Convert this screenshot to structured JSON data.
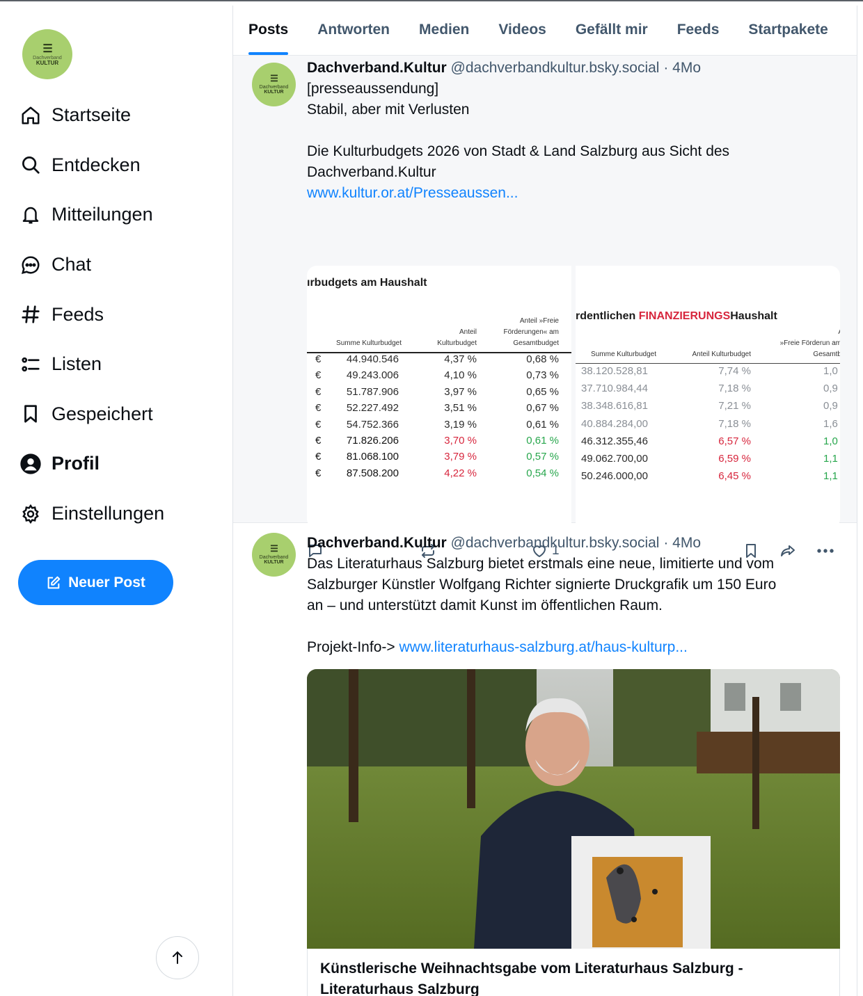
{
  "sidebar": {
    "avatar": {
      "brand_small": "Dachverband",
      "brand": "KULTUR"
    },
    "items": [
      {
        "label": "Startseite",
        "icon": "home-icon"
      },
      {
        "label": "Entdecken",
        "icon": "search-icon"
      },
      {
        "label": "Mitteilungen",
        "icon": "bell-icon"
      },
      {
        "label": "Chat",
        "icon": "chat-bubble-icon"
      },
      {
        "label": "Feeds",
        "icon": "hash-icon"
      },
      {
        "label": "Listen",
        "icon": "list-icon"
      },
      {
        "label": "Gespeichert",
        "icon": "bookmark-icon"
      },
      {
        "label": "Profil",
        "icon": "person-icon"
      },
      {
        "label": "Einstellungen",
        "icon": "gear-icon"
      }
    ],
    "active_item": "Profil",
    "new_post_label": "Neuer Post"
  },
  "tabs": [
    "Posts",
    "Antworten",
    "Medien",
    "Videos",
    "Gefällt mir",
    "Feeds",
    "Startpakete"
  ],
  "active_tab": "Posts",
  "accent_color": "#1083fe",
  "posts": [
    {
      "author": "Dachverband.Kultur",
      "handle": "@dachverbandkultur.bsky.social",
      "dot": "·",
      "time": "4Mo",
      "lines": [
        "[presseaussendung]",
        "Stabil, aber mit Verlusten",
        "",
        "Die Kulturbudgets 2026 von Stadt & Land Salzburg aus Sicht des",
        "Dachverband.Kultur"
      ],
      "link": "www.kultur.or.at/Presseaussen...",
      "table_left": {
        "title": "ırbudgets am Haushalt",
        "headers": [
          "Summe Kulturbudget",
          "Anteil Kulturbudget",
          "Anteil »Freie Förderungen« am Gesamtbudget"
        ],
        "currency": "€",
        "rows": [
          [
            "44.940.546",
            "4,37 %",
            "0,68 %"
          ],
          [
            "49.243.006",
            "4,10 %",
            "0,73 %"
          ],
          [
            "51.787.906",
            "3,97 %",
            "0,65 %"
          ],
          [
            "52.227.492",
            "3,51 %",
            "0,67 %"
          ],
          [
            "54.752.366",
            "3,19 %",
            "0,61 %"
          ],
          [
            "71.826.206",
            "3,70 %",
            "0,61 %"
          ],
          [
            "81.068.100",
            "3,79 %",
            "0,57 %"
          ],
          [
            "87.508.200",
            "4,22 %",
            "0,54 %"
          ]
        ]
      },
      "table_right": {
        "title_prefix": "rdentlichen ",
        "title_red": "FINANZIERUNGS",
        "title_suffix": "Haushalt",
        "headers": [
          "Summe Kulturbudget",
          "Anteil Kulturbudget",
          "»Freie Förderun am Gesamtb"
        ],
        "header_extra": "A",
        "rows": [
          [
            "38.120.528,81",
            "7,74 %",
            "1,0"
          ],
          [
            "37.710.984,44",
            "7,18 %",
            "0,9"
          ],
          [
            "38.348.616,81",
            "7,21 %",
            "0,9"
          ],
          [
            "40.884.284,00",
            "7,18 %",
            "1,6"
          ],
          [
            "46.312.355,46",
            "6,57 %",
            "1,0"
          ],
          [
            "49.062.700,00",
            "6,59 %",
            "1,1"
          ],
          [
            "50.246.000,00",
            "6,45 %",
            "1,1"
          ]
        ]
      },
      "like_count": "1"
    },
    {
      "author": "Dachverband.Kultur",
      "handle": "@dachverbandkultur.bsky.social",
      "dot": "·",
      "time": "4Mo",
      "lines": [
        "Das Literaturhaus Salzburg bietet erstmals eine neue, limitierte und vom",
        "Salzburger Künstler Wolfgang Richter signierte Druckgrafik um 150 Euro",
        "an – und unterstützt damit Kunst im öffentlichen Raum.",
        ""
      ],
      "link_prefix": "Projekt-Info-> ",
      "link": "www.literaturhaus-salzburg.at/haus-kulturp...",
      "card_title_1": "Künstlerische Weihnachtsgabe vom Literaturhaus Salzburg -",
      "card_title_2": "Literaturhaus Salzburg"
    }
  ]
}
